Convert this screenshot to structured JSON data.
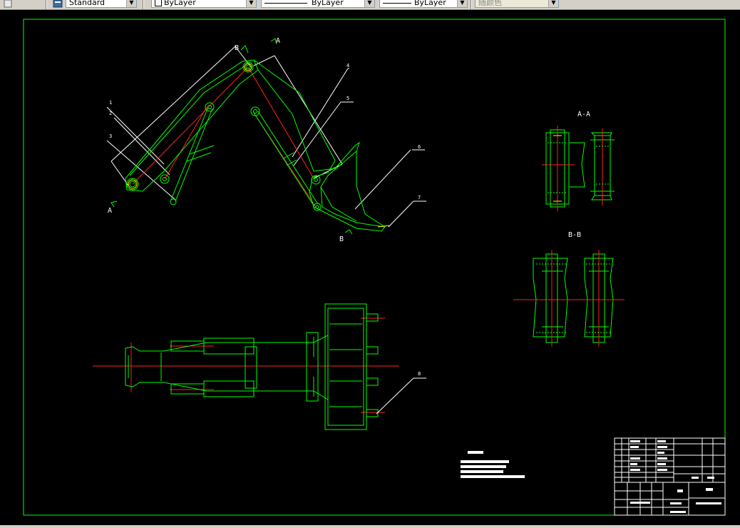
{
  "toolbar": {
    "text_style": "Standard",
    "layer_color": "ByLayer",
    "linetype": "ByLayer",
    "lineweight": "ByLayer",
    "plot_style": "随颜色"
  },
  "drawing": {
    "view_labels": {
      "section_a": "A-A",
      "section_b": "B-B"
    },
    "cut_markers": {
      "a_top": "A",
      "a_bottom": "A",
      "b_top": "B",
      "b_bottom": "B"
    },
    "balloons": [
      "1",
      "2",
      "3",
      "4",
      "5",
      "6",
      "7",
      "8"
    ]
  }
}
